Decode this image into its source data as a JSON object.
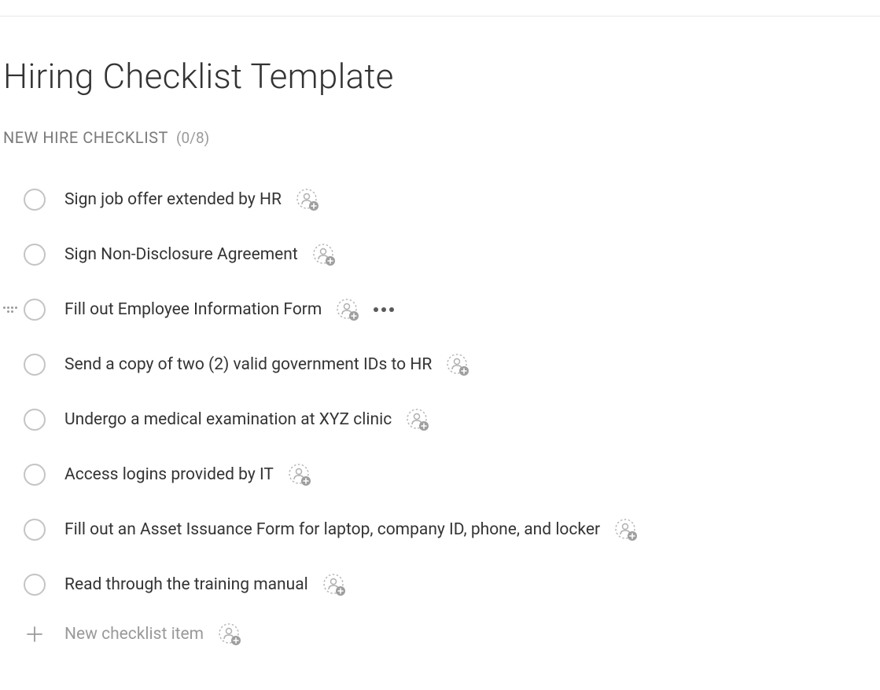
{
  "page": {
    "title": "Hiring Checklist Template"
  },
  "section": {
    "title": "NEW HIRE CHECKLIST",
    "count": "(0/8)"
  },
  "items": [
    {
      "label": "Sign job offer extended by HR",
      "hovered": false
    },
    {
      "label": "Sign Non-Disclosure Agreement",
      "hovered": false
    },
    {
      "label": "Fill out Employee Information Form",
      "hovered": true
    },
    {
      "label": "Send a copy of two (2) valid government IDs to HR",
      "hovered": false
    },
    {
      "label": "Undergo a medical examination at XYZ clinic",
      "hovered": false
    },
    {
      "label": "Access logins provided by IT",
      "hovered": false
    },
    {
      "label": "Fill out an Asset Issuance Form for laptop, company ID, phone, and locker",
      "hovered": false
    },
    {
      "label": "Read through the training manual",
      "hovered": false
    }
  ],
  "newItem": {
    "placeholder": "New checklist item"
  }
}
